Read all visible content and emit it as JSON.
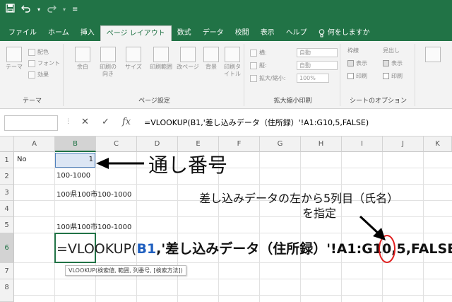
{
  "ribbon_tabs": [
    "ファイル",
    "ホーム",
    "挿入",
    "ページ レイアウト",
    "数式",
    "データ",
    "校閲",
    "表示",
    "ヘルプ",
    "何をしますか"
  ],
  "ribbon": {
    "theme_group": {
      "label": "テーマ",
      "theme_btn": "テーマ",
      "colors": "配色",
      "fonts": "フォント",
      "effects": "効果"
    },
    "page_setup": {
      "label": "ページ設定",
      "margins": "余白",
      "orientation": "印刷の向き",
      "size": "サイズ",
      "print_area": "印刷範囲",
      "breaks": "改ページ",
      "background": "背景",
      "print_titles": "印刷タイトル"
    },
    "scale": {
      "label": "拡大縮小印刷",
      "width_label": "横:",
      "width_val": "自動",
      "height_label": "縦:",
      "height_val": "自動",
      "scale_label": "拡大/縮小:",
      "scale_val": "100%"
    },
    "sheet_options": {
      "label": "シートのオプション",
      "gridlines": "枠線",
      "headings": "見出し",
      "view": "表示",
      "print": "印刷"
    }
  },
  "formula_bar": {
    "cancel": "✕",
    "enter": "✓",
    "fx": "fx",
    "formula": "=VLOOKUP(B1,'差し込みデータ（住所録）'!A1:G10,5,FALSE)"
  },
  "columns": [
    "A",
    "B",
    "C",
    "D",
    "E",
    "F",
    "G",
    "H",
    "I",
    "J",
    "K"
  ],
  "rows": [
    "1",
    "2",
    "3",
    "4",
    "5",
    "6",
    "7",
    "8"
  ],
  "cells": {
    "A1": "No",
    "B1": "1",
    "B2": "100-1000",
    "B3": "100県100市100-1000",
    "B5": "100県100市100-1000"
  },
  "edit": {
    "prefix": "=VLOOKUP(",
    "ref": "B1",
    "rest": ",'差し込みデータ（住所録）'!A1:G10,",
    "index": "5",
    "tail": ",FALSE)",
    "tooltip": "VLOOKUP(検索値, 範囲, 列番号, [検索方法])"
  },
  "annotations": {
    "serial": "通し番号",
    "col5_line1": "差し込みデータの左から5列目（氏名）",
    "col5_line2": "を指定"
  }
}
